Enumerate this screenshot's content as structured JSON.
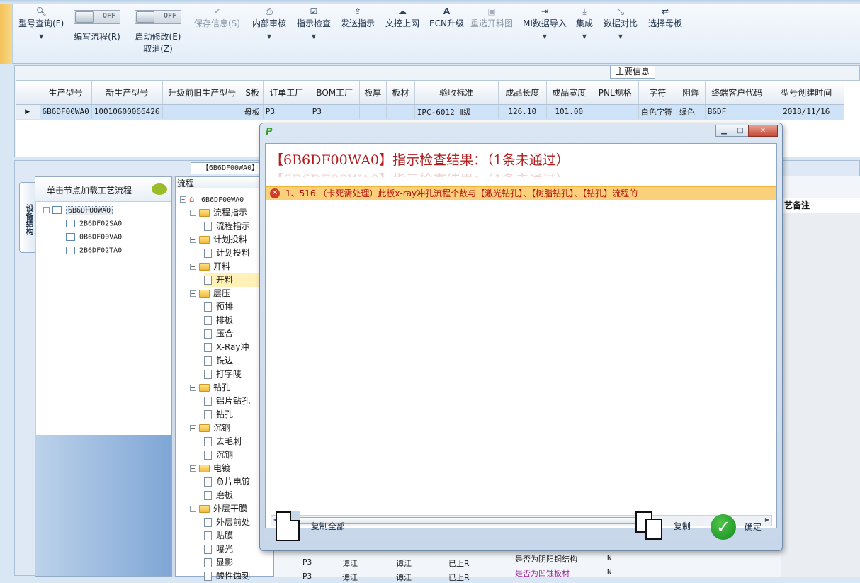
{
  "toolbar": {
    "items": [
      {
        "label": "型号查询(F)",
        "icon": "search-icon"
      },
      {
        "label": "编写流程(R)",
        "toggle": "OFF"
      },
      {
        "label": "启动修改(E)",
        "sublabel": "取消(Z)",
        "toggle": "OFF"
      },
      {
        "label": "保存信息(S)",
        "icon": "check-icon",
        "disabled": true
      },
      {
        "label": "内部审核",
        "icon": "print-icon"
      },
      {
        "label": "指示检查",
        "icon": "checkbox-icon"
      },
      {
        "label": "发送指示",
        "icon": "upload-icon"
      },
      {
        "label": "文控上网",
        "icon": "cloud-upload-icon"
      },
      {
        "label": "ECN升级",
        "icon": "font-icon"
      },
      {
        "label": "重选开料图",
        "icon": "picture-icon",
        "disabled": true
      },
      {
        "label": "MI数据导入",
        "icon": "sign-in-icon"
      },
      {
        "label": "集成",
        "icon": "download-icon"
      },
      {
        "label": "数据对比",
        "icon": "compress-icon"
      },
      {
        "label": "选择母板",
        "icon": "shuffle-icon"
      }
    ]
  },
  "main_info": {
    "tab_title": "主要信息",
    "columns": [
      "生产型号",
      "新生产型号",
      "升级前旧生产型号",
      "S板",
      "订单工厂",
      "BOM工厂",
      "板厚",
      "板材",
      "验收标准",
      "成品长度",
      "成品宽度",
      "PNL规格",
      "字符",
      "阻焊",
      "终端客户代码",
      "型号创建时间"
    ],
    "row": [
      "6B6DF00WA0",
      "10010600066426",
      "",
      "母板",
      "P3",
      "P3",
      "",
      "",
      "IPC-6012 Ⅱ级",
      "126.10",
      "101.00",
      "",
      "白色字符",
      "绿色",
      "B6DF",
      "2018/11/16"
    ]
  },
  "lower": {
    "module_tab": "【6B6DF00WA0】",
    "vertical_tab": "设备结构",
    "left_header": "单击节点加载工艺流程",
    "left_tree": {
      "root": "6B6DF00WA0",
      "children": [
        "2B6DF02SA0",
        "0B6DF00VA0",
        "2B6DF02TA0"
      ]
    },
    "flow_title": "流程",
    "flow_root": "6B6DF00WA0",
    "flow_nodes": [
      {
        "label": "流程指示",
        "type": "folder"
      },
      {
        "label": "流程指示",
        "type": "doc"
      },
      {
        "label": "计划投料",
        "type": "folder"
      },
      {
        "label": "计划投料",
        "type": "doc"
      },
      {
        "label": "开料",
        "type": "folder"
      },
      {
        "label": "开料",
        "type": "doc",
        "selected": true
      },
      {
        "label": "层压",
        "type": "folder"
      },
      {
        "label": "预排",
        "type": "doc"
      },
      {
        "label": "排板",
        "type": "doc"
      },
      {
        "label": "压合",
        "type": "doc"
      },
      {
        "label": "X-Ray冲",
        "type": "doc"
      },
      {
        "label": "铣边",
        "type": "doc"
      },
      {
        "label": "打字唛",
        "type": "doc"
      },
      {
        "label": "钻孔",
        "type": "folder"
      },
      {
        "label": "铝片钻孔",
        "type": "doc"
      },
      {
        "label": "钻孔",
        "type": "doc"
      },
      {
        "label": "沉铜",
        "type": "folder"
      },
      {
        "label": "去毛刺",
        "type": "doc"
      },
      {
        "label": "沉铜",
        "type": "doc"
      },
      {
        "label": "电镀",
        "type": "folder"
      },
      {
        "label": "负片电镀",
        "type": "doc"
      },
      {
        "label": "磨板",
        "type": "doc"
      },
      {
        "label": "外层干膜",
        "type": "folder"
      },
      {
        "label": "外层前处",
        "type": "doc"
      },
      {
        "label": "贴膜",
        "type": "doc"
      },
      {
        "label": "曝光",
        "type": "doc"
      },
      {
        "label": "显影",
        "type": "doc"
      },
      {
        "label": "酸性蚀刻",
        "type": "doc"
      }
    ],
    "tech_tab": "艺备注",
    "behind_rows": [
      {
        "c1": "P3",
        "c2": "谭江",
        "c3": "谭江",
        "c4": "已上R"
      },
      {
        "c1": "P3",
        "c2": "谭江",
        "c3": "谭江",
        "c4": "已上R"
      }
    ],
    "behind_props": [
      {
        "label": "是否为阴阳铜结构",
        "value": "N"
      },
      {
        "label": "是否为凹蚀板材",
        "value": "N"
      }
    ]
  },
  "dialog": {
    "app_icon": "P",
    "result_title": "【6B6DF00WA0】指示检查结果：（1条未通过）",
    "failures": [
      "1、516.（卡死需处理）此板x-ray冲孔流程个数与【激光钻孔】、【树脂钻孔】、【钻孔】流程的"
    ],
    "buttons": {
      "copy_all": "复制全部",
      "copy": "复制",
      "ok": "确定"
    }
  }
}
